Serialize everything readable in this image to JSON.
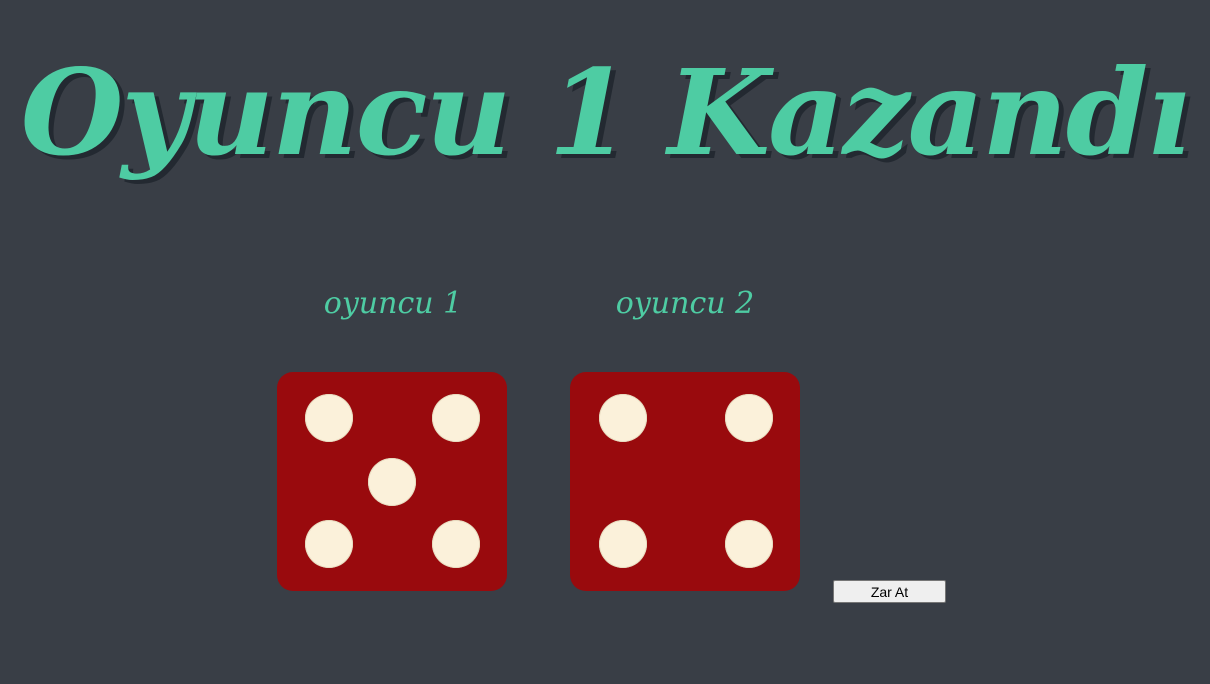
{
  "header": {
    "title": "Oyuncu 1 Kazandı"
  },
  "players": [
    {
      "label": "oyuncu 1",
      "die_value": 5
    },
    {
      "label": "oyuncu 2",
      "die_value": 4
    }
  ],
  "controls": {
    "roll_button_label": "Zar At"
  },
  "colors": {
    "background": "#393e46",
    "accent": "#4ecca3",
    "die_face": "#990a0d",
    "pip": "#fbf1da"
  }
}
